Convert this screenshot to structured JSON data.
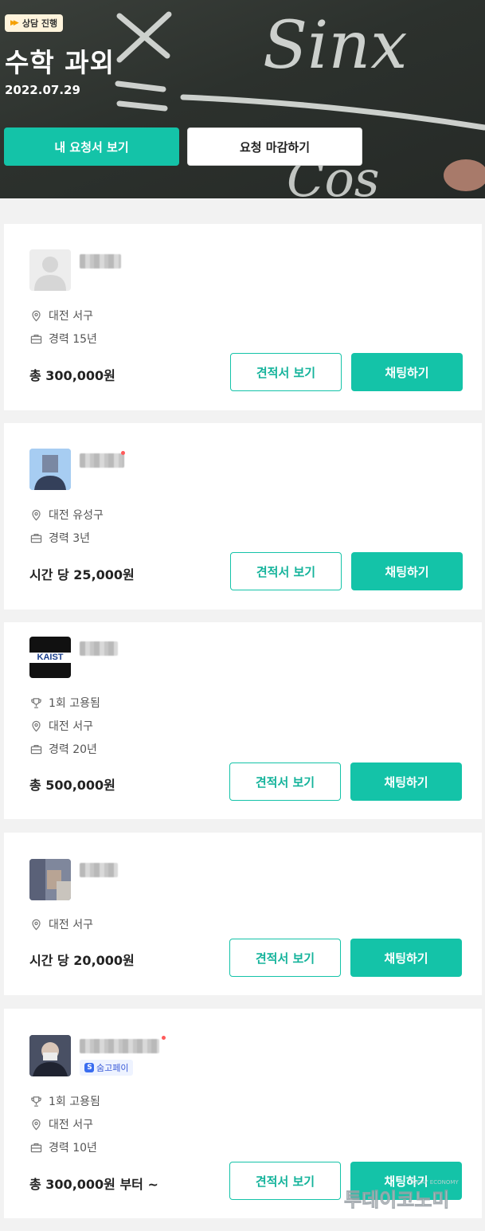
{
  "header": {
    "badge": "상담 진행",
    "title": "수학 과외",
    "date": "2022.07.29",
    "primary_button": "내 요청서 보기",
    "secondary_button": "요청 마감하기",
    "chalk_text": [
      "Sinx",
      "Cos"
    ]
  },
  "colors": {
    "accent": "#14c3a8",
    "badge_bg": "#fff4dc"
  },
  "quote_label": "견적서 보기",
  "chat_label": "채팅하기",
  "experts": [
    {
      "location": "대전 서구",
      "career": "경력 15년",
      "price": "총 300,000원"
    },
    {
      "location": "대전 유성구",
      "career": "경력 3년",
      "price": "시간 당 25,000원"
    },
    {
      "avatar_text": "KAIST",
      "hires": "1회 고용됨",
      "location": "대전 서구",
      "career": "경력 20년",
      "price": "총 500,000원"
    },
    {
      "location": "대전 서구",
      "price": "시간 당 20,000원"
    },
    {
      "pay_badge": "숨고페이",
      "hires": "1회 고용됨",
      "location": "대전 서구",
      "career": "경력 10년",
      "price": "총 300,000원 부터 ~"
    }
  ],
  "watermark": {
    "brand": "투데이코노미",
    "sub": "TODAY ECONOMY"
  }
}
